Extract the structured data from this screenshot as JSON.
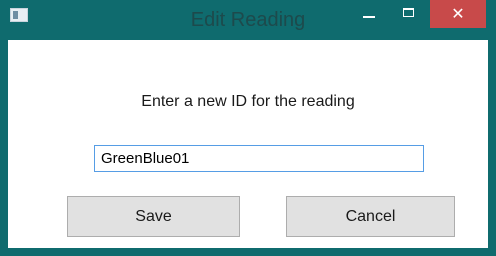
{
  "window": {
    "title": "Edit Reading",
    "icons": {
      "app": "app-window-icon",
      "minimize": "minimize-icon",
      "maximize": "maximize-icon",
      "close": "close-icon"
    },
    "close_glyph": "✕",
    "colors": {
      "frame": "#0f6b6e",
      "title_text": "#1d4a4c",
      "close_button": "#c84a4a",
      "input_border": "#569de5",
      "button_face": "#e1e1e1"
    }
  },
  "dialog": {
    "prompt": "Enter a new ID for the reading",
    "id_value": "GreenBlue01",
    "save_label": "Save",
    "cancel_label": "Cancel"
  }
}
